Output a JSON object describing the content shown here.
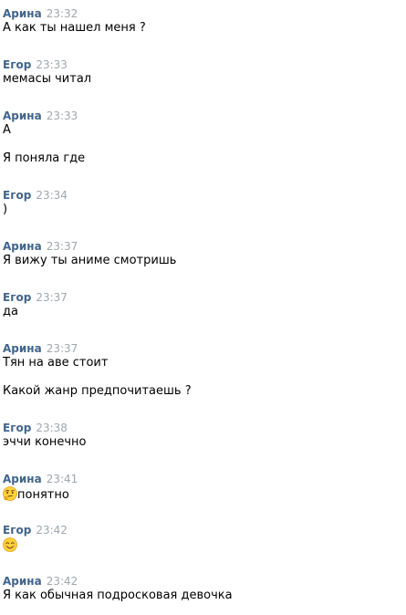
{
  "messages": [
    {
      "author": "Арина",
      "time": "23:32",
      "lines": [
        "А как ты нашел меня ?"
      ]
    },
    {
      "author": "Егор",
      "time": "23:33",
      "lines": [
        "мемасы читал"
      ]
    },
    {
      "author": "Арина",
      "time": "23:33",
      "lines": [
        "А",
        "Я поняла где"
      ]
    },
    {
      "author": "Егор",
      "time": "23:34",
      "lines": [
        ")"
      ]
    },
    {
      "author": "Арина",
      "time": "23:37",
      "lines": [
        "Я вижу ты аниме смотришь"
      ]
    },
    {
      "author": "Егор",
      "time": "23:37",
      "lines": [
        "да"
      ]
    },
    {
      "author": "Арина",
      "time": "23:37",
      "lines": [
        "Тян на аве стоит",
        "Какой жанр предпочитаешь ?"
      ]
    },
    {
      "author": "Егор",
      "time": "23:38",
      "lines": [
        "эччи конечно"
      ]
    },
    {
      "author": "Арина",
      "time": "23:41",
      "emoji": "thinking-face-emoji",
      "lines": [
        "понятно"
      ]
    },
    {
      "author": "Егор",
      "time": "23:42",
      "emoji": "smiling-face-emoji",
      "lines": [
        ""
      ]
    },
    {
      "author": "Арина",
      "time": "23:42",
      "lines": [
        "Я как обычная подросковая девочка"
      ]
    }
  ],
  "colors": {
    "author": "#42648b",
    "time": "#a0a7ae",
    "text": "#000000",
    "background": "#ffffff"
  }
}
